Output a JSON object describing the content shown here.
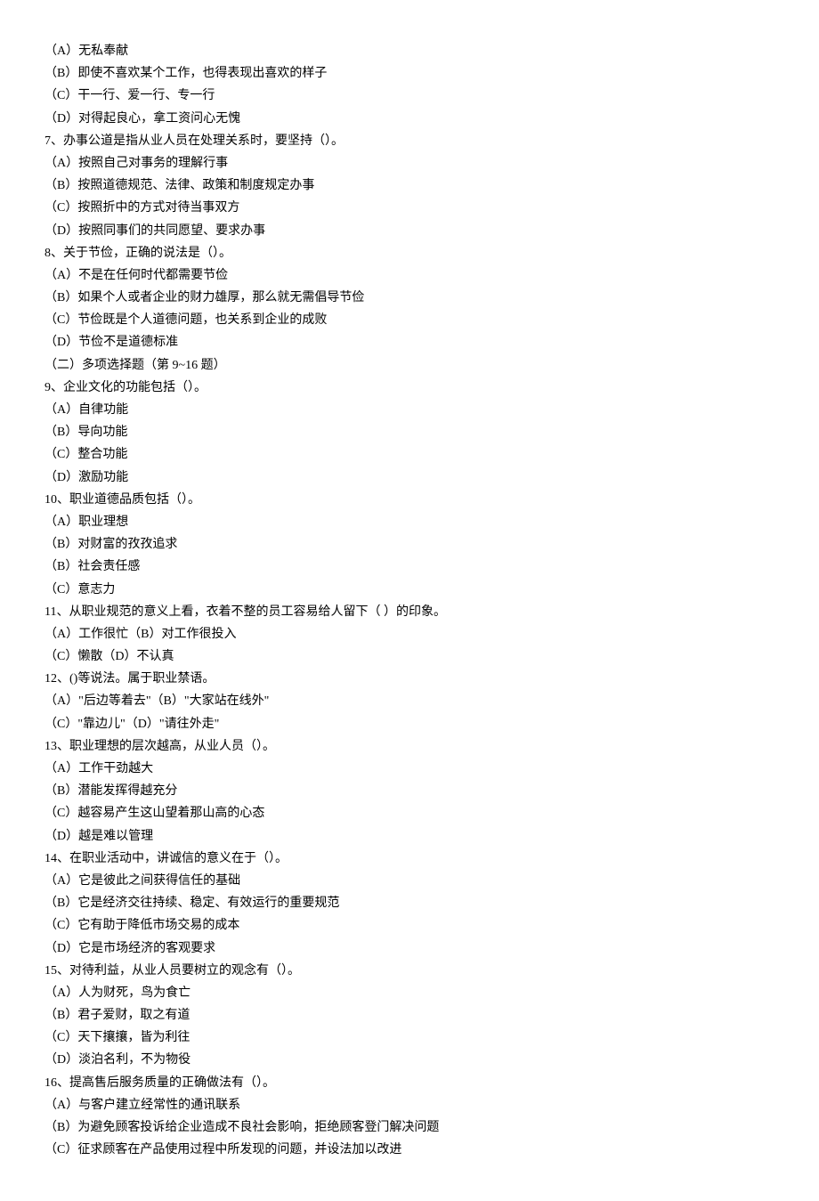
{
  "lines": [
    "（A）无私奉献",
    "（B）即使不喜欢某个工作，也得表现出喜欢的样子",
    "（C）干一行、爱一行、专一行",
    "（D）对得起良心，拿工资问心无愧",
    "7、办事公道是指从业人员在处理关系时，要坚持（）。",
    "（A）按照自己对事务的理解行事",
    "（B）按照道德规范、法律、政策和制度规定办事",
    "（C）按照折中的方式对待当事双方",
    "（D）按照同事们的共同愿望、要求办事",
    "8、关于节俭，正确的说法是（）。",
    "（A）不是在任何时代都需要节俭",
    "（B）如果个人或者企业的财力雄厚，那么就无需倡导节俭",
    "（C）节俭既是个人道德问题，也关系到企业的成败",
    "（D）节俭不是道德标准",
    "（二）多项选择题（第 9~16 题）",
    "9、企业文化的功能包括（）。",
    "（A）自律功能",
    "（B）导向功能",
    "（C）整合功能",
    "（D）激励功能",
    "10、职业道德品质包括（）。",
    "（A）职业理想",
    "（B）对财富的孜孜追求",
    "（B）社会责任感",
    "（C）意志力",
    "11、从职业规范的意义上看，衣着不整的员工容易给人留下（ ）的印象。",
    "（A）工作很忙（B）对工作很投入",
    "（C）懒散（D）不认真",
    "12、()等说法。属于职业禁语。",
    "（A）\"后边等着去\"（B）\"大家站在线外\"",
    "（C）\"靠边儿\"（D）\"请往外走\"",
    "13、职业理想的层次越高，从业人员（）。",
    "（A）工作干劲越大",
    "（B）潜能发挥得越充分",
    "（C）越容易产生这山望着那山高的心态",
    "（D）越是难以管理",
    "14、在职业活动中，讲诚信的意义在于（）。",
    "（A）它是彼此之间获得信任的基础",
    "（B）它是经济交往持续、稳定、有效运行的重要规范",
    "（C）它有助于降低市场交易的成本",
    "（D）它是市场经济的客观要求",
    "15、对待利益，从业人员要树立的观念有（）。",
    "（A）人为财死，鸟为食亡",
    "（B）君子爱财，取之有道",
    "（C）天下攘攘，皆为利往",
    "（D）淡泊名利，不为物役",
    "16、提高售后服务质量的正确做法有（）。",
    "（A）与客户建立经常性的通讯联系",
    "（B）为避免顾客投诉给企业造成不良社会影响，拒绝顾客登门解决问题",
    "（C）征求顾客在产品使用过程中所发现的问题，并设法加以改进"
  ]
}
